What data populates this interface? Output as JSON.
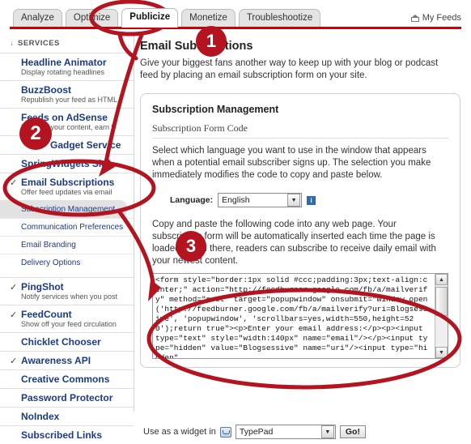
{
  "tabs": [
    {
      "label": "Analyze",
      "active": false
    },
    {
      "label": "Optimize",
      "active": false
    },
    {
      "label": "Publicize",
      "active": true
    },
    {
      "label": "Monetize",
      "active": false
    },
    {
      "label": "Troubleshootize",
      "active": false
    }
  ],
  "header": {
    "my_feeds_label": "My Feeds",
    "home_icon": "home-icon"
  },
  "sidebar": {
    "header": "SERVICES",
    "header_arrow": "↓",
    "services": [
      {
        "name": "Headline Animator",
        "desc": "Display rotating headlines",
        "checked": false
      },
      {
        "name": "BuzzBoost",
        "desc": "Republish your feed as HTML",
        "checked": false
      },
      {
        "name": "Feeds on AdSense",
        "desc": "Promote your content, earn $",
        "checked": false
      },
      {
        "name": "Gadget Service",
        "desc": "",
        "checked": false
      },
      {
        "name": "SpringWidgets Skin",
        "desc": "",
        "checked": false
      },
      {
        "name": "Email Subscriptions",
        "desc": "Offer feed updates via email",
        "checked": true
      }
    ],
    "subitems": [
      {
        "label": "Subscription Management",
        "selected": true
      },
      {
        "label": "Communication Preferences",
        "selected": false
      },
      {
        "label": "Email Branding",
        "selected": false
      },
      {
        "label": "Delivery Options",
        "selected": false
      }
    ],
    "services2": [
      {
        "name": "PingShot",
        "desc": "Notify services when you post",
        "checked": true
      },
      {
        "name": "FeedCount",
        "desc": "Show off your feed circulation",
        "checked": true
      },
      {
        "name": "Chicklet Chooser",
        "desc": "",
        "checked": false
      },
      {
        "name": "Awareness API",
        "desc": "",
        "checked": true
      },
      {
        "name": "Creative Commons",
        "desc": "",
        "checked": false
      },
      {
        "name": "Password Protector",
        "desc": "",
        "checked": false
      },
      {
        "name": "NoIndex",
        "desc": "",
        "checked": false
      },
      {
        "name": "Subscribed Links",
        "desc": "",
        "checked": false
      }
    ],
    "check_glyph": "✓"
  },
  "main": {
    "page_title": "Email Subscriptions",
    "page_subtitle": "Give your biggest fans another way to keep up with your blog or podcast feed by placing an email subscription form on your site.",
    "panel_title": "Subscription Management",
    "section_title": "Subscription Form Code",
    "language_intro": "Select which language you want to use in the window that appears when a potential email subscriber signs up. The selection you make immediately modifies the code to copy and paste below.",
    "language_label": "Language:",
    "language_value": "English",
    "language_options": [
      "English"
    ],
    "info_icon": "info-icon",
    "info_glyph": "i",
    "copy_text": "Copy and paste the following code into any web page. Your subscription form will be automatically inserted each time the page is loaded. From there, readers can subscribe to receive daily email with your newest content.",
    "code": "<form style=\"border:1px solid #ccc;padding:3px;text-align:center;\" action=\"http://feedburner.google.com/fb/a/mailverify\" method=\"post\" target=\"popupwindow\" onsubmit=\"window.open('http://feedburner.google.com/fb/a/mailverify?uri=Blogsessive', 'popupwindow', 'scrollbars=yes,width=550,height=520');return true\"><p>Enter your email address:</p><p><input type=\"text\" style=\"width:140px\" name=\"email\"/></p><input type=\"hidden\" value=\"Blogsessive\" name=\"uri\"/><input type=\"hidden\"",
    "widget_label": "Use as a widget in",
    "widget_icon": "widget-icon",
    "widget_value": "TypePad",
    "widget_options": [
      "TypePad"
    ],
    "go_label": "Go!",
    "scroll_up_glyph": "▲",
    "scroll_down_glyph": "▼",
    "select_arrow_glyph": "▼"
  },
  "annotations": {
    "badge1": "1",
    "badge2": "2",
    "badge3": "3",
    "color": "#b3141f"
  }
}
